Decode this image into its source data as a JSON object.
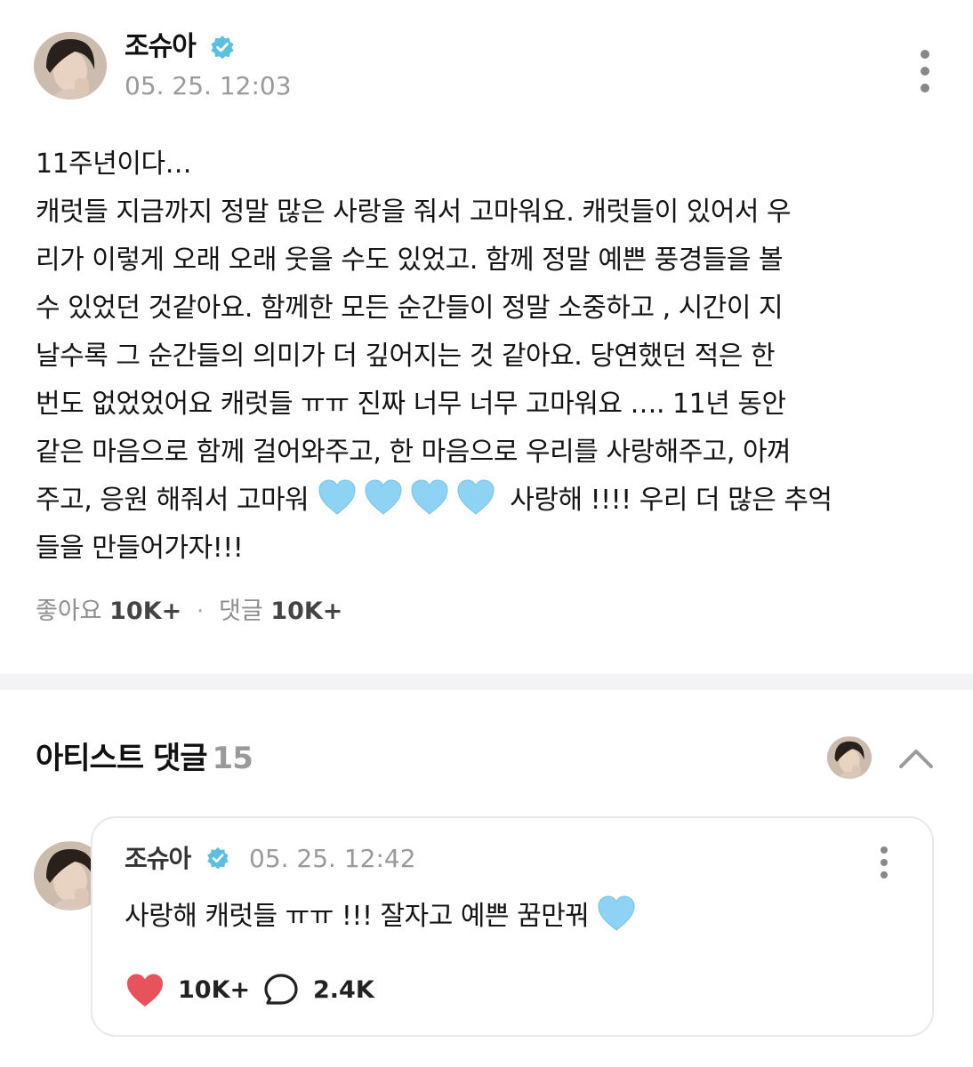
{
  "post": {
    "author": "조슈아",
    "time": "05. 25. 12:03",
    "body_lines": [
      "11주년이다…",
      "캐럿들 지금까지 정말 많은 사랑을 줘서 고마워요. 캐럿들이 있어서 우",
      "리가 이렇게 오래 오래 웃을 수도 있었고. 함께 정말 예쁜 풍경들을 볼",
      "수 있었던 것같아요. 함께한 모든 순간들이 정말 소중하고 ,  시간이 지",
      "날수록 그 순간들의 의미가 더 깊어지는 것 같아요. 당연했던 적은 한",
      "번도 없었었어요 캐럿들 ㅠㅠ 진짜 너무 너무 고마워요 …. 11년 동안",
      "같은 마음으로 함께 걸어와주고, 한 마음으로 우리를 사랑해주고, 아껴",
      "주고, 응원 해줘서 고마워",
      " 사랑해 !!!! 우리 더 많은 추억",
      "들을 만들어가자!!!"
    ],
    "stats": {
      "likes_label": "좋아요",
      "likes_value": "10K+",
      "comments_label": "댓글",
      "comments_value": "10K+"
    }
  },
  "artist_comments": {
    "title": "아티스트 댓글",
    "count": "15"
  },
  "comment": {
    "author": "조슈아",
    "time": "05. 25. 12:42",
    "text": "사랑해 캐럿들 ㅠㅠ !!! 잘자고 예쁜 꿈만꿔",
    "likes": "10K+",
    "replies": "2.4K"
  },
  "colors": {
    "verified": "#5bc0de",
    "heart_emoji": "#8fd3f4",
    "like_heart": "#e8525a",
    "muted_text": "#9a9a9a",
    "divider": "#f3f3f5"
  },
  "icons": [
    "verified-badge-icon",
    "more-options-icon",
    "blue-heart-emoji",
    "chevron-up-icon",
    "like-heart-icon",
    "comment-bubble-icon"
  ]
}
